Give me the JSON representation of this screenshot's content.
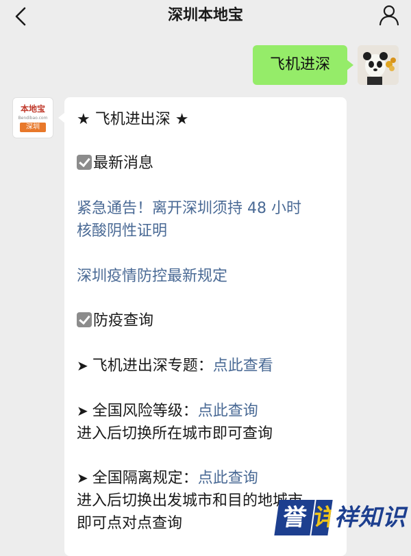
{
  "header": {
    "title": "深圳本地宝"
  },
  "chat": {
    "outgoing_message": "飞机进深",
    "bot_logo": {
      "top_text": "本地宝",
      "url_text": "Bendibao.com",
      "city_tag": "深圳"
    },
    "reply": {
      "heading": "★ 飞机进出深 ★",
      "section1_title": "最新消息",
      "link1_line1": "紧急通告！离开深圳须持 48 小时",
      "link1_line2": "核酸阴性证明",
      "link2": "深圳疫情防控最新规定",
      "section2_title": "防疫查询",
      "item1_label": "飞机进出深专题：",
      "item1_link": "点此查看",
      "item2_label": "全国风险等级：",
      "item2_link": "点此查询",
      "item2_note": "进入后切换所在城市即可查询",
      "item3_label": "全国隔离规定：",
      "item3_link": "点此查询",
      "item3_note_line1": "进入后切换出发城市和目的地城市",
      "item3_note_line2": "即可点对点查询"
    }
  },
  "watermark": {
    "char1": "誉",
    "char2": "详",
    "text": "祥知识"
  },
  "colors": {
    "background": "#ededed",
    "outgoing_bubble": "#95ec69",
    "link": "#4a6a95",
    "logo_orange": "#e8782a",
    "watermark_blue": "#1d3f8f"
  },
  "icons": {
    "back": "chevron-left-icon",
    "profile": "person-icon",
    "check": "checkbox-checked-icon",
    "arrow": "arrowhead-right-icon"
  }
}
